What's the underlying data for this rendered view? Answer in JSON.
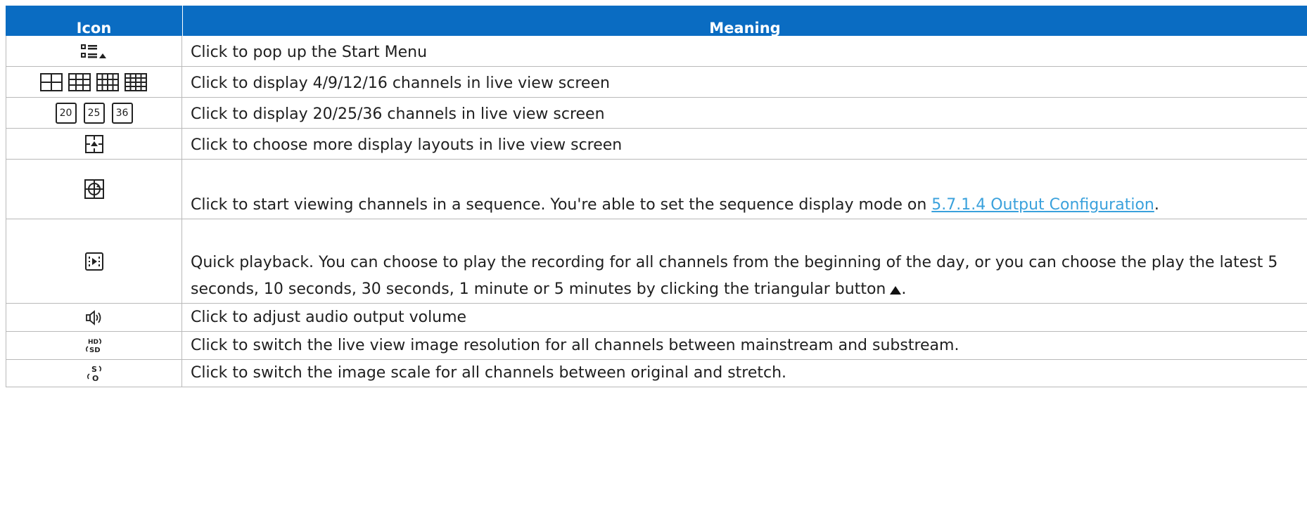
{
  "header": {
    "icon_col": "Icon",
    "meaning_col": "Meaning"
  },
  "rows": [
    {
      "icon": "start-menu-icon",
      "text": "Click to pop up the Start Menu"
    },
    {
      "icon": "grid-layouts-icon",
      "text": "Click to display 4/9/12/16 channels in live view screen"
    },
    {
      "icon": "channel-count-icons",
      "labels": [
        "20",
        "25",
        "36"
      ],
      "text": "Click to display 20/25/36 channels in live view screen"
    },
    {
      "icon": "more-layouts-icon",
      "text": "Click to choose more display layouts in live view screen"
    },
    {
      "icon": "sequence-view-icon",
      "text_before": "Click to start viewing channels in a sequence. You're able to set the sequence display mode on ",
      "link": "5.7.1.4 Output Configuration",
      "text_after": "."
    },
    {
      "icon": "quick-playback-icon",
      "text": "Quick playback. You can choose to play the recording for all channels from the beginning of the day, or you can choose the play the latest 5 seconds, 10 seconds, 30 seconds, 1 minute or 5 minutes by clicking the triangular button"
    },
    {
      "icon": "speaker-volume-icon",
      "text": "Click to adjust audio output volume"
    },
    {
      "icon": "hd-sd-switch-icon",
      "text": "Click to switch the live view image resolution for all channels between mainstream and substream."
    },
    {
      "icon": "scale-switch-icon",
      "text": "Click to switch the image scale for all channels between original and stretch."
    }
  ]
}
